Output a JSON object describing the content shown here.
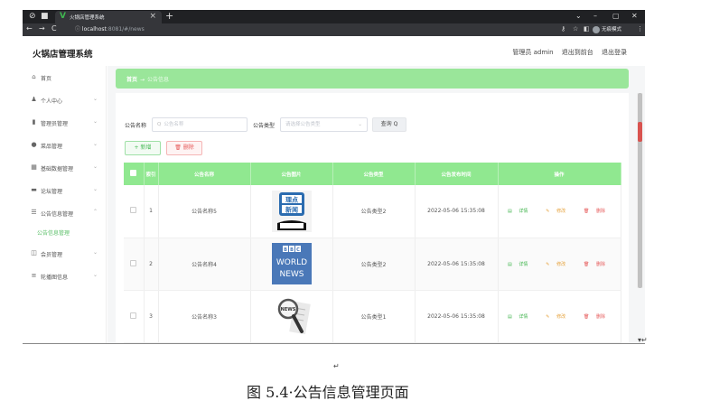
{
  "browser": {
    "tab_title": "火锅店管理系统",
    "url_host": "localhost",
    "url_path": ":8081/#/news",
    "profile_label": "无痕模式"
  },
  "app": {
    "title": "火锅店管理系统",
    "user_label": "管理员 admin",
    "to_front": "退出到前台",
    "logout": "退出登录"
  },
  "sidebar": {
    "items": [
      {
        "label": "首页",
        "icon": "home-icon",
        "glyph": "⌂",
        "expandable": false
      },
      {
        "label": "个人中心",
        "icon": "user-icon",
        "glyph": "♟",
        "expandable": true
      },
      {
        "label": "管理员管理",
        "icon": "bar-chart-icon",
        "glyph": "▮",
        "expandable": true
      },
      {
        "label": "菜品管理",
        "icon": "location-icon",
        "glyph": "●",
        "expandable": true
      },
      {
        "label": "基础数据管理",
        "icon": "grid-icon",
        "glyph": "▦",
        "expandable": true
      },
      {
        "label": "论坛管理",
        "icon": "chat-icon",
        "glyph": "▬",
        "expandable": true
      },
      {
        "label": "公告信息管理",
        "icon": "sliders-icon",
        "glyph": "☰",
        "expandable": true,
        "expanded": true
      },
      {
        "label": "会员管理",
        "icon": "member-icon",
        "glyph": "◫",
        "expandable": true
      },
      {
        "label": "轮播图信息",
        "icon": "list-icon",
        "glyph": "≡",
        "expandable": true
      }
    ],
    "submenu_active": "公告信息管理"
  },
  "breadcrumb": {
    "home": "首页",
    "separator": "→",
    "current": "公告信息"
  },
  "filters": {
    "name_label": "公告名称",
    "name_placeholder": "公告名称",
    "type_label": "公告类型",
    "type_placeholder": "请选择公告类型",
    "search_button": "查询"
  },
  "actions": {
    "add": "+ 新增",
    "delete": "删除"
  },
  "table": {
    "headers": [
      "",
      "索引",
      "公告名称",
      "公告图片",
      "公告类型",
      "公告发布时间",
      "操作"
    ],
    "rows": [
      {
        "index": "1",
        "name": "公告名称5",
        "image": "thumb-news-phone",
        "type": "公告类型2",
        "time": "2022-05-06 15:35:08"
      },
      {
        "index": "2",
        "name": "公告名称4",
        "image": "thumb-bbc-world-news",
        "type": "公告类型2",
        "time": "2022-05-06 15:35:08"
      },
      {
        "index": "3",
        "name": "公告名称3",
        "image": "thumb-magnifier-news",
        "type": "公告类型1",
        "time": "2022-05-06 15:35:08"
      }
    ],
    "ops": {
      "detail": "详情",
      "edit": "修改",
      "delete": "删除"
    },
    "thumb_text": {
      "news_cn_1": "理点",
      "news_cn_2": "新闻",
      "bbc": "BBC",
      "world": "WORLD",
      "news": "NEWS"
    }
  },
  "document": {
    "caption": "图 5.4·公告信息管理页面",
    "para_mark": "↵"
  },
  "colors": {
    "accent_green": "#90e890",
    "crumb_green": "#9ae69a",
    "danger": "#e65a5a",
    "warning": "#e6a23c"
  }
}
